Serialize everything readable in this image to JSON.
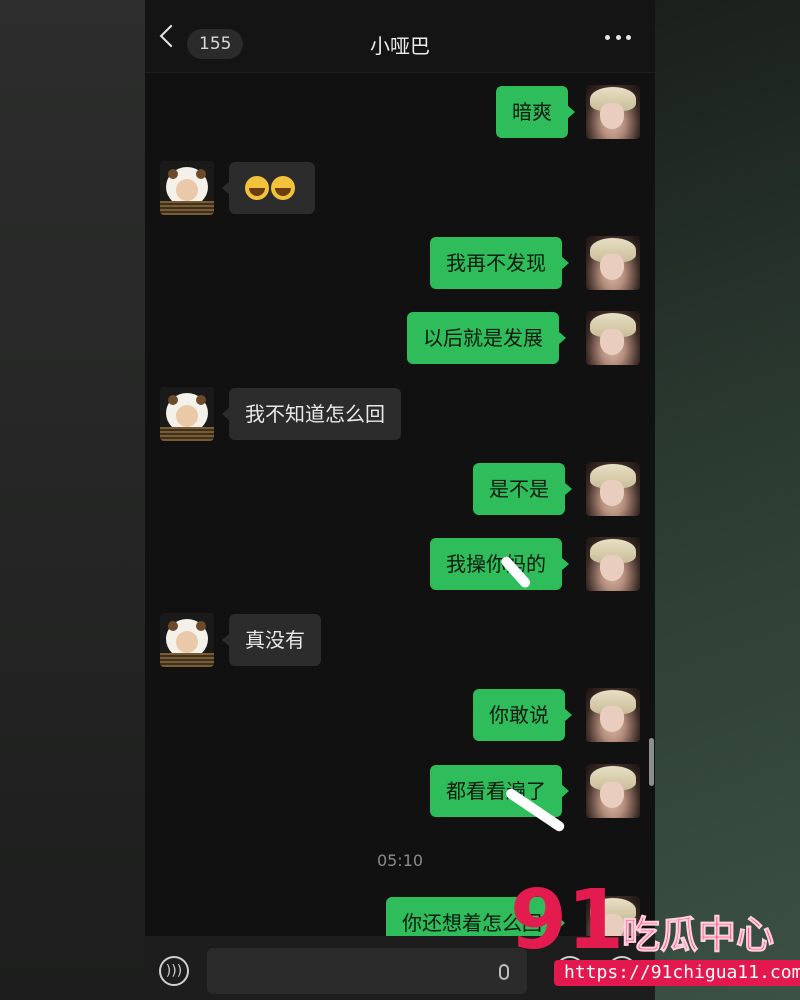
{
  "header": {
    "unread_count": "155",
    "title": "小哑巴"
  },
  "messages": [
    {
      "side": "me",
      "text": "暗爽"
    },
    {
      "side": "them",
      "text": "",
      "content": "emoji",
      "emoji": [
        "laughing-crying",
        "laughing-crying"
      ]
    },
    {
      "side": "me",
      "text": "我再不发现"
    },
    {
      "side": "me",
      "text": "以后就是发展"
    },
    {
      "side": "them",
      "text": "我不知道怎么回"
    },
    {
      "side": "me",
      "text": "是不是"
    },
    {
      "side": "me",
      "text": "我操你妈的"
    },
    {
      "side": "them",
      "text": "真没有"
    },
    {
      "side": "me",
      "text": "你敢说"
    },
    {
      "side": "me",
      "text": "都看看遍了"
    }
  ],
  "timestamp": "05:10",
  "last_message": {
    "side": "me",
    "text": "你还想着怎么回"
  },
  "watermark": {
    "number": "91",
    "brand": "吃瓜中心",
    "url": "https://91chigua11.com"
  },
  "colors": {
    "my_bubble": "#2fbd5b",
    "their_bubble": "#2c2c2c",
    "background": "#111111",
    "watermark": "#e31b4f"
  },
  "icons": {
    "back": "chevron-left-icon",
    "more": "more-dots-icon",
    "voice": "voice-icon",
    "mic": "mic-icon",
    "emoji": "emoji-icon",
    "plus": "plus-icon"
  }
}
